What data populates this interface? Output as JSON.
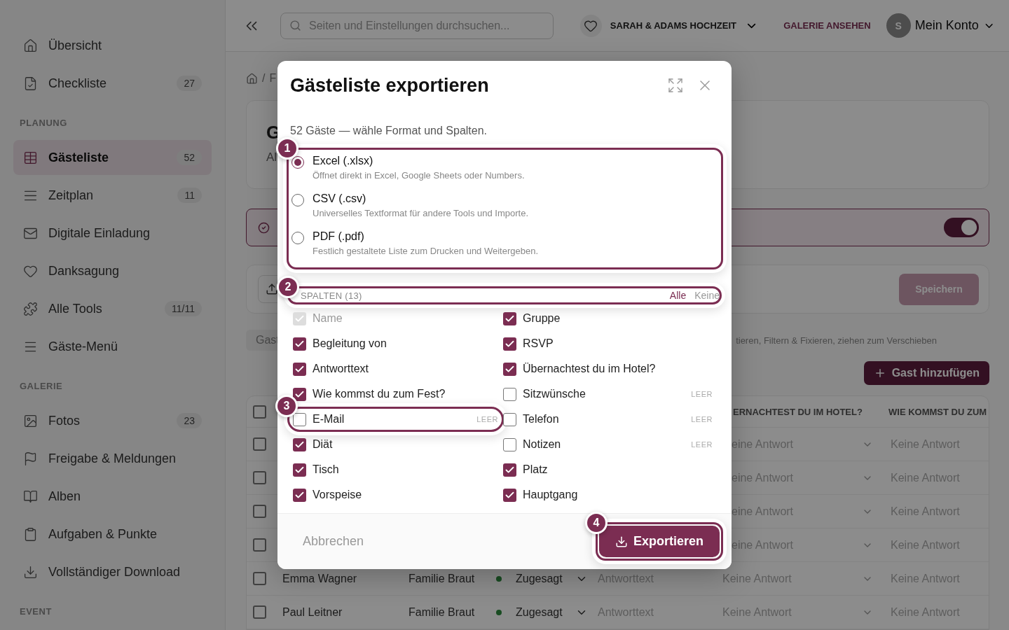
{
  "sidebar": {
    "sections": [
      {
        "items": [
          {
            "label": "Übersicht",
            "selected": false
          },
          {
            "label": "Checkliste",
            "badge": "27",
            "selected": false
          }
        ]
      },
      {
        "heading": "PLANUNG",
        "items": [
          {
            "label": "Gästeliste",
            "badge": "52",
            "selected": true
          },
          {
            "label": "Zeitplan",
            "badge": "11",
            "selected": false
          },
          {
            "label": "Digitale Einladung",
            "selected": false
          },
          {
            "label": "Danksagung",
            "selected": false
          },
          {
            "label": "Alle Tools",
            "badge": "11/11",
            "selected": false
          },
          {
            "label": "Gäste-Menü",
            "selected": false
          }
        ]
      },
      {
        "heading": "GALERIE",
        "items": [
          {
            "label": "Fotos",
            "badge": "23",
            "selected": false
          },
          {
            "label": "Freigabe & Meldungen",
            "selected": false
          },
          {
            "label": "Alben",
            "selected": false
          },
          {
            "label": "Aufgaben & Punkte",
            "selected": false
          },
          {
            "label": "Vollständiger Download",
            "selected": false
          }
        ]
      },
      {
        "heading": "EVENT"
      }
    ]
  },
  "topbar": {
    "search_placeholder": "Seiten und Einstellungen durchsuchen...",
    "event": "SARAH & ADAMS HOCHZEIT",
    "gallery_link": "GALERIE ANSEHEN",
    "avatar": "S",
    "account": "Mein Konto"
  },
  "background": {
    "breadcrumb_separator": "/",
    "breadcrumb": "F",
    "header": {
      "title": "G",
      "subtitle": "Al"
    },
    "alert": {
      "on": true
    },
    "save_button": {
      "label": "Speichern",
      "disabled": true
    },
    "search_value": "Gast",
    "hint": "tieren, Filtern & Fixieren, ziehen zum Verschieben",
    "add_button": "Gast hinzufügen",
    "table": {
      "all_checked": false,
      "columns": [
        "ERNACHTEST DU IM HOTEL?",
        "WIE KOMMST DU ZUM"
      ],
      "rows": [
        {
          "checked": false,
          "hotel": "eine Antwort",
          "travel": "Keine Antwort"
        },
        {
          "checked": false,
          "hotel": "eine Antwort",
          "travel": "Keine Antwort"
        },
        {
          "checked": false,
          "hotel": "eine Antwort",
          "travel": "Keine Antwort"
        },
        {
          "checked": false,
          "hotel": "eine Antwort",
          "travel": "Keine Antwort"
        },
        {
          "checked": false,
          "name": "Emma Wagner",
          "group": "Familie Braut",
          "status": "Zugesagt",
          "answer": "Antworttext",
          "hotel": "Keine Antwort",
          "travel": "Keine Antwort"
        },
        {
          "checked": false,
          "name": "Paul Leitner",
          "group": "Familie Braut",
          "status": "Zugesagt",
          "answer": "Antworttext",
          "hotel": "Keine Antwort",
          "travel": "Keine Antwort"
        }
      ]
    }
  },
  "dialog": {
    "title": "Gästeliste exportieren",
    "subtitle": "52 Gäste — wähle Format und Spalten.",
    "formats": {
      "callout": "1",
      "options": [
        {
          "label": "Excel (.xlsx)",
          "description": "Öffnet direkt in Excel, Google Sheets oder Numbers.",
          "selected": true
        },
        {
          "label": "CSV (.csv)",
          "description": "Universelles Textformat für andere Tools und Importe.",
          "selected": false
        },
        {
          "label": "PDF (.pdf)",
          "description": "Festlich gestaltete Liste zum Drucken und Weitergeben.",
          "selected": false
        }
      ]
    },
    "columns": {
      "callout": "2",
      "heading": "SPALTEN (13)",
      "select_all": "Alle",
      "select_none": "Keine",
      "items": [
        {
          "label": "Name",
          "checked": true,
          "disabled": true
        },
        {
          "label": "Gruppe",
          "checked": true,
          "disabled": false
        },
        {
          "label": "Begleitung von",
          "checked": true,
          "disabled": false
        },
        {
          "label": "RSVP",
          "checked": true,
          "disabled": false
        },
        {
          "label": "Antworttext",
          "checked": true,
          "disabled": false
        },
        {
          "label": "Übernachtest du im Hotel?",
          "checked": true,
          "disabled": false
        },
        {
          "label": "Wie kommst du zum Fest?",
          "checked": true,
          "disabled": false
        },
        {
          "label": "Sitzwünsche",
          "checked": false,
          "disabled": false,
          "tag": "LEER"
        },
        {
          "label": "E-Mail",
          "checked": false,
          "disabled": false,
          "tag": "LEER",
          "callout": "3"
        },
        {
          "label": "Telefon",
          "checked": false,
          "disabled": false,
          "tag": "LEER"
        },
        {
          "label": "Diät",
          "checked": true,
          "disabled": false
        },
        {
          "label": "Notizen",
          "checked": false,
          "disabled": false,
          "tag": "LEER"
        },
        {
          "label": "Tisch",
          "checked": true,
          "disabled": false
        },
        {
          "label": "Platz",
          "checked": true,
          "disabled": false
        },
        {
          "label": "Vorspeise",
          "checked": true,
          "disabled": false
        },
        {
          "label": "Hauptgang",
          "checked": true,
          "disabled": false
        }
      ]
    },
    "cancel": "Abbrechen",
    "export": {
      "label": "Exportieren",
      "callout": "4"
    }
  }
}
